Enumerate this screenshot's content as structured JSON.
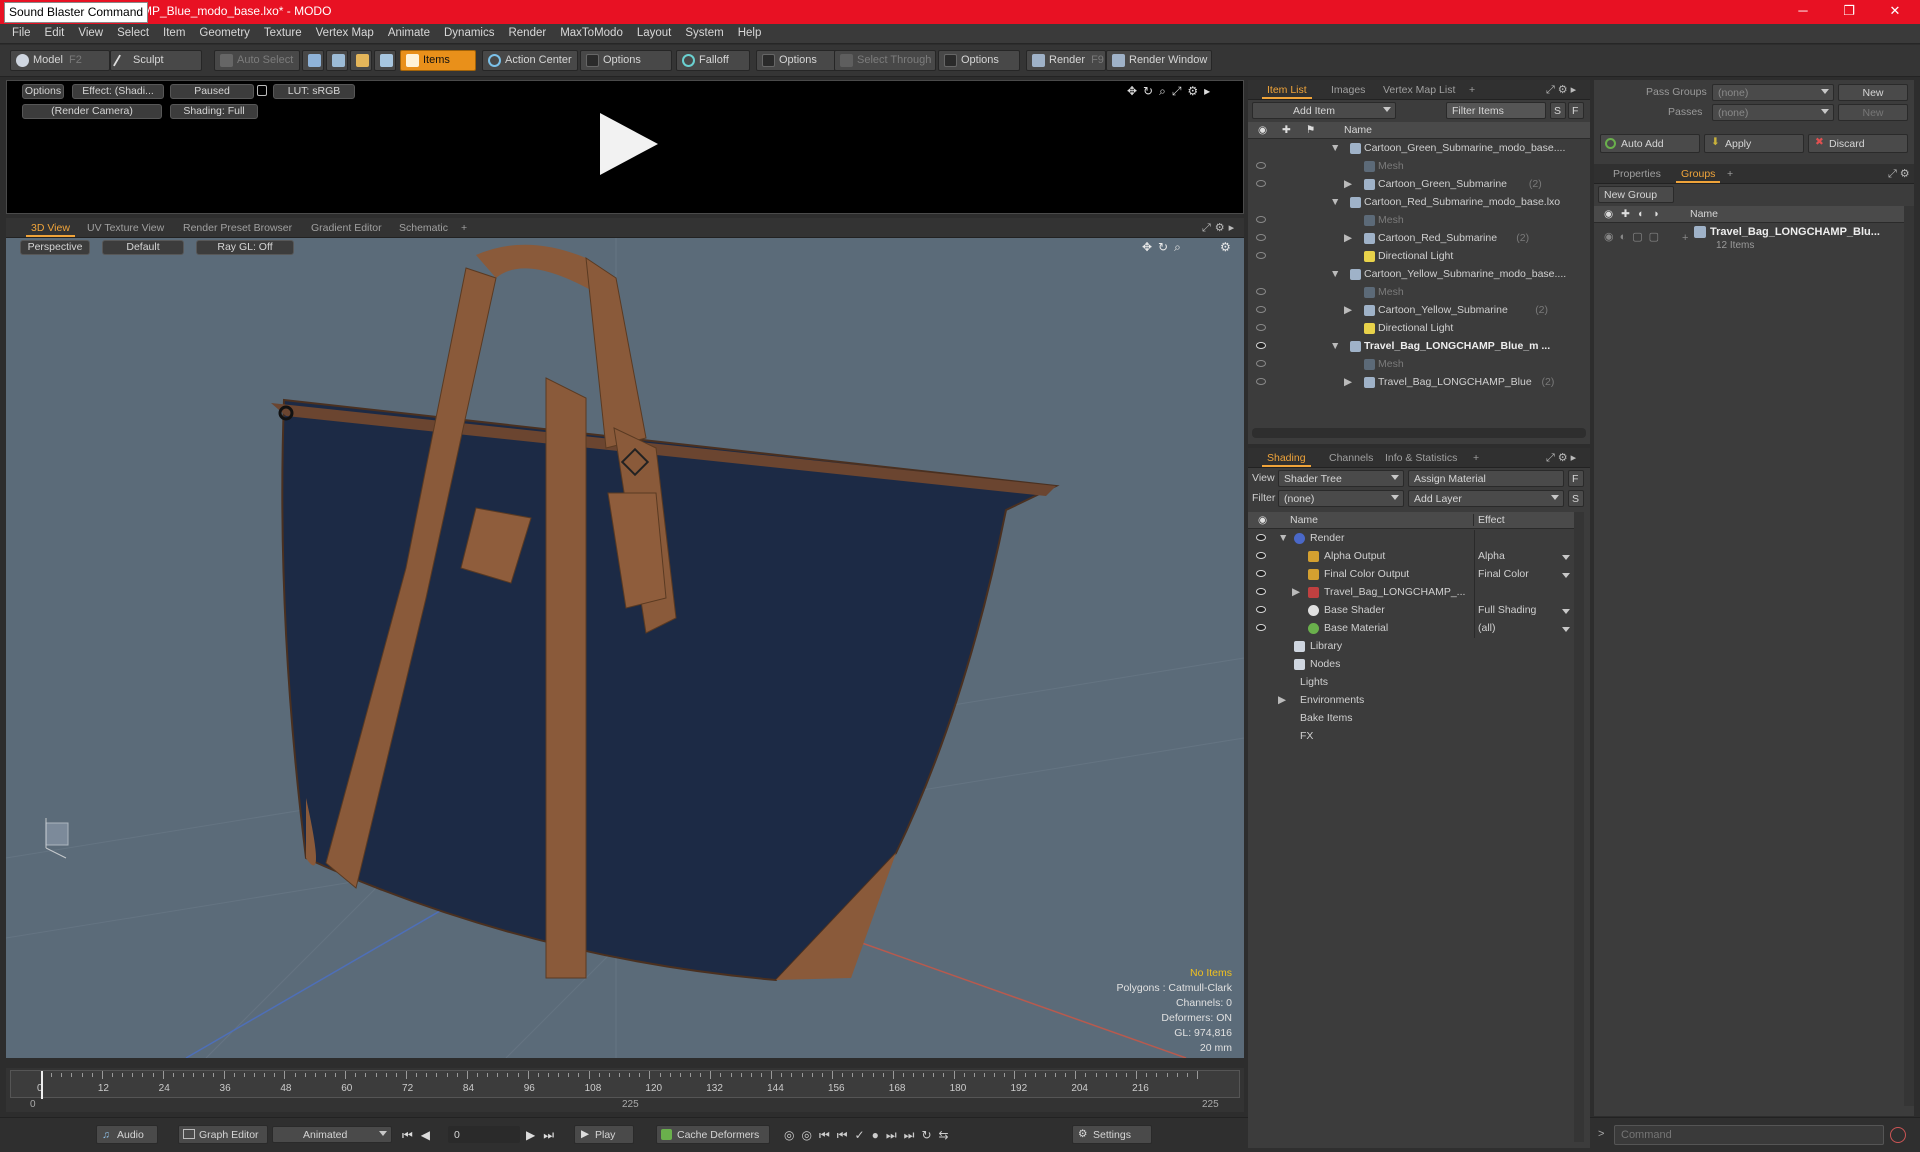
{
  "window": {
    "overlay_label": "Sound Blaster Command",
    "title": "MP_Blue_modo_base.lxo* - MODO",
    "controls": [
      "─",
      "❐",
      "✕"
    ]
  },
  "menu": [
    "File",
    "Edit",
    "View",
    "Select",
    "Item",
    "Geometry",
    "Texture",
    "Vertex Map",
    "Animate",
    "Dynamics",
    "Render",
    "MaxToModo",
    "Layout",
    "System",
    "Help"
  ],
  "toolbar": {
    "model": "Model",
    "model_key": "F2",
    "sculpt": "Sculpt",
    "auto_select": "Auto Select",
    "items": "Items",
    "action_center": "Action Center",
    "options1": "Options",
    "falloff": "Falloff",
    "options2": "Options",
    "select_through": "Select Through",
    "options3": "Options",
    "render": "Render",
    "render_key": "F9",
    "render_window": "Render Window"
  },
  "preview": {
    "options": "Options",
    "effect": "Effect: (Shadi...",
    "paused": "Paused",
    "lut": "LUT: sRGB",
    "camera": "(Render Camera)",
    "shading": "Shading: Full"
  },
  "viewport_tabs": [
    "3D View",
    "UV Texture View",
    "Render Preset Browser",
    "Gradient Editor",
    "Schematic",
    "+"
  ],
  "viewport": {
    "perspective": "Perspective",
    "default": "Default",
    "raygl": "Ray GL: Off",
    "hud": {
      "no_items": "No Items",
      "polygons": "Polygons : Catmull-Clark",
      "channels": "Channels: 0",
      "deformers": "Deformers: ON",
      "gl": "GL: 974,816",
      "scale": "20 mm"
    }
  },
  "timeline": {
    "ticks": [
      "0",
      "12",
      "24",
      "36",
      "48",
      "60",
      "72",
      "84",
      "96",
      "108",
      "120",
      "132",
      "144",
      "156",
      "168",
      "180",
      "192",
      "204",
      "216"
    ],
    "start": "0",
    "mid": "225",
    "end": "225"
  },
  "bottom": {
    "audio": "Audio",
    "graph_editor": "Graph Editor",
    "animated": "Animated",
    "frame": "0",
    "play": "Play",
    "cache_deformers": "Cache Deformers",
    "settings": "Settings",
    "command_placeholder": "Command"
  },
  "item_list": {
    "tabs": [
      "Item List",
      "Images",
      "Vertex Map List",
      "+"
    ],
    "add_item": "Add Item",
    "filter": "Filter Items",
    "s": "S",
    "f": "F",
    "col_name": "Name",
    "rows": [
      {
        "label": "Cartoon_Green_Submarine_modo_base....",
        "style": "",
        "indent": 0,
        "count": ""
      },
      {
        "label": "Mesh",
        "style": "dim",
        "indent": 1,
        "count": ""
      },
      {
        "label": "Cartoon_Green_Submarine",
        "style": "",
        "indent": 1,
        "count": "(2)"
      },
      {
        "label": "Cartoon_Red_Submarine_modo_base.lxo",
        "style": "",
        "indent": 0,
        "count": ""
      },
      {
        "label": "Mesh",
        "style": "dim",
        "indent": 1,
        "count": ""
      },
      {
        "label": "Cartoon_Red_Submarine",
        "style": "",
        "indent": 1,
        "count": "(2)"
      },
      {
        "label": "Directional Light",
        "style": "",
        "indent": 1,
        "count": ""
      },
      {
        "label": "Cartoon_Yellow_Submarine_modo_base....",
        "style": "",
        "indent": 0,
        "count": ""
      },
      {
        "label": "Mesh",
        "style": "dim",
        "indent": 1,
        "count": ""
      },
      {
        "label": "Cartoon_Yellow_Submarine",
        "style": "",
        "indent": 1,
        "count": "(2)"
      },
      {
        "label": "Directional Light",
        "style": "",
        "indent": 1,
        "count": ""
      },
      {
        "label": "Travel_Bag_LONGCHAMP_Blue_m ...",
        "style": "bold",
        "indent": 0,
        "count": ""
      },
      {
        "label": "Mesh",
        "style": "dim",
        "indent": 1,
        "count": ""
      },
      {
        "label": "Travel_Bag_LONGCHAMP_Blue",
        "style": "",
        "indent": 1,
        "count": "(2)"
      }
    ]
  },
  "shading": {
    "tabs": [
      "Shading",
      "Channels",
      "Info & Statistics",
      "+"
    ],
    "view_label": "View",
    "view_value": "Shader Tree",
    "assign_material": "Assign Material",
    "filter_label": "Filter",
    "filter_value": "(none)",
    "add_layer": "Add Layer",
    "f": "F",
    "s": "S",
    "col_name": "Name",
    "col_effect": "Effect",
    "rows": [
      {
        "label": "Render",
        "effect": "",
        "indent": 0
      },
      {
        "label": "Alpha Output",
        "effect": "Alpha",
        "indent": 1
      },
      {
        "label": "Final Color Output",
        "effect": "Final Color",
        "indent": 1
      },
      {
        "label": "Travel_Bag_LONGCHAMP_...",
        "effect": "",
        "indent": 1
      },
      {
        "label": "Base Shader",
        "effect": "Full Shading",
        "indent": 1
      },
      {
        "label": "Base Material",
        "effect": "(all)",
        "indent": 1
      },
      {
        "label": "Library",
        "effect": "",
        "indent": 0
      },
      {
        "label": "Nodes",
        "effect": "",
        "indent": 0
      },
      {
        "label": "Lights",
        "effect": "",
        "indent": 0
      },
      {
        "label": "Environments",
        "effect": "",
        "indent": 0
      },
      {
        "label": "Bake Items",
        "effect": "",
        "indent": 0
      },
      {
        "label": "FX",
        "effect": "",
        "indent": 0
      }
    ]
  },
  "groups_panel": {
    "pass_groups_label": "Pass Groups",
    "pass_groups_value": "(none)",
    "new": "New",
    "passes_label": "Passes",
    "passes_value": "(none)",
    "new2": "New",
    "auto_add": "Auto Add",
    "apply": "Apply",
    "discard": "Discard",
    "tabs": [
      "Properties",
      "Groups",
      "+"
    ],
    "new_group": "New Group",
    "col_name": "Name",
    "group_name": "Travel_Bag_LONGCHAMP_Blu...",
    "group_count": "12 Items"
  },
  "colors": {
    "accent": "#e9901a",
    "title_red": "#e81123",
    "bag_blue": "#1c2a45",
    "leather": "#8a5a3a",
    "viewport": "#5b6b79"
  }
}
